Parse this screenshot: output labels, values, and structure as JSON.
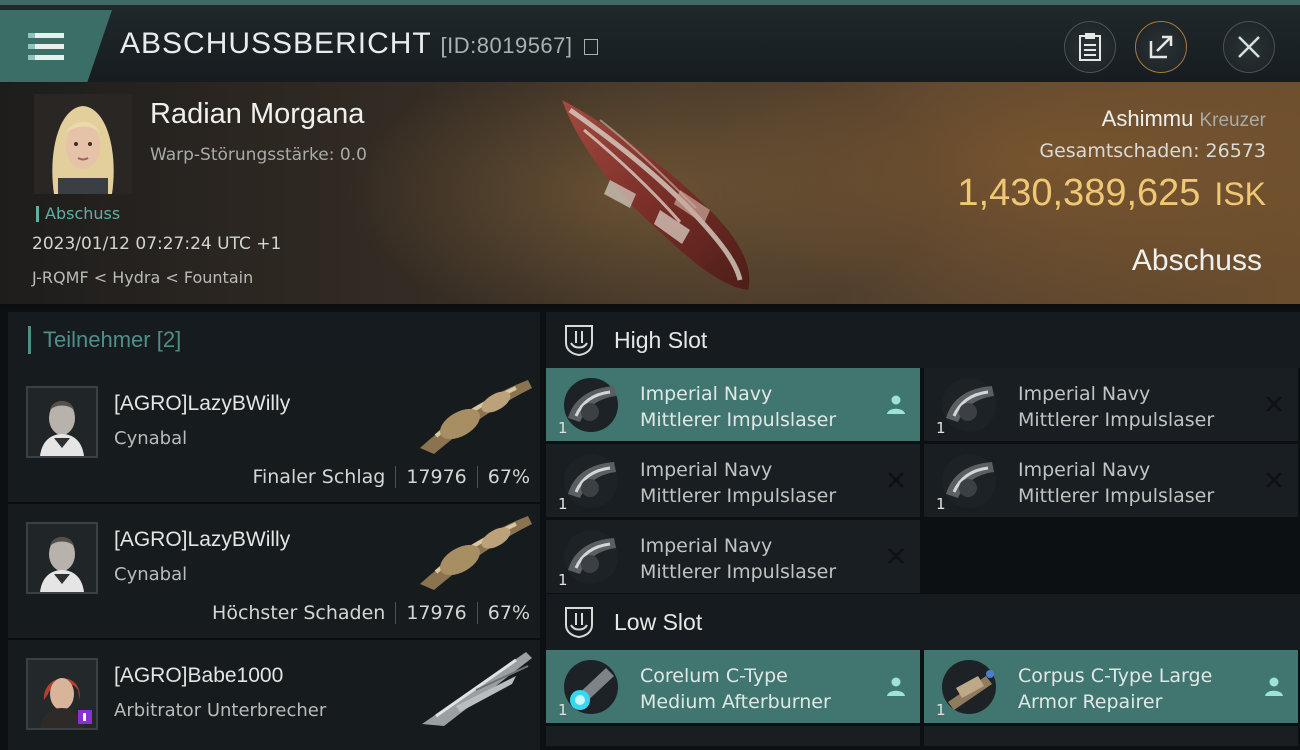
{
  "header": {
    "title": "ABSCHUSSBERICHT",
    "id_text": "[ID:8019567]"
  },
  "victim": {
    "name": "Radian Morgana",
    "warp_strength": "Warp-Störungsstärke: 0.0",
    "tag": "Abschuss",
    "datetime": "2023/01/12 07:27:24 UTC +1",
    "location": "J-RQMF < Hydra < Fountain",
    "ship": "Ashimmu",
    "ship_class": "Kreuzer",
    "damage_label": "Gesamtschaden:",
    "damage_value": "26573",
    "isk_value": "1,430,389,625",
    "isk_unit": "ISK",
    "result": "Abschuss"
  },
  "participants": {
    "label": "Teilnehmer",
    "count": "[2]",
    "rows": [
      {
        "name": "[AGRO]LazyBWilly",
        "ship": "Cynabal",
        "role": "Finaler Schlag",
        "damage": "17976",
        "percent": "67%"
      },
      {
        "name": "[AGRO]LazyBWilly",
        "ship": "Cynabal",
        "role": "Höchster Schaden",
        "damage": "17976",
        "percent": "67%"
      },
      {
        "name": "[AGRO]Babe1000",
        "ship": "Arbitrator Unterbrecher",
        "role": "",
        "damage": "",
        "percent": ""
      }
    ]
  },
  "high_slot": {
    "label": "High Slot",
    "items": [
      {
        "line1": "Imperial Navy",
        "line2": "Mittlerer Impulslaser",
        "qty": "1",
        "state": "dropped"
      },
      {
        "line1": "Imperial Navy",
        "line2": "Mittlerer Impulslaser",
        "qty": "1",
        "state": "destroyed"
      },
      {
        "line1": "Imperial Navy",
        "line2": "Mittlerer Impulslaser",
        "qty": "1",
        "state": "destroyed"
      },
      {
        "line1": "Imperial Navy",
        "line2": "Mittlerer Impulslaser",
        "qty": "1",
        "state": "destroyed"
      },
      {
        "line1": "Imperial Navy",
        "line2": "Mittlerer Impulslaser",
        "qty": "1",
        "state": "destroyed"
      }
    ]
  },
  "low_slot": {
    "label": "Low Slot",
    "items": [
      {
        "line1": "Corelum C-Type",
        "line2": "Medium Afterburner",
        "qty": "1",
        "state": "dropped"
      },
      {
        "line1": "Corpus C-Type Large",
        "line2": "Armor Repairer",
        "qty": "1",
        "state": "dropped"
      }
    ]
  },
  "colors": {
    "accent": "#417670",
    "isk": "#f0c775",
    "tag": "#5fb0a3"
  }
}
